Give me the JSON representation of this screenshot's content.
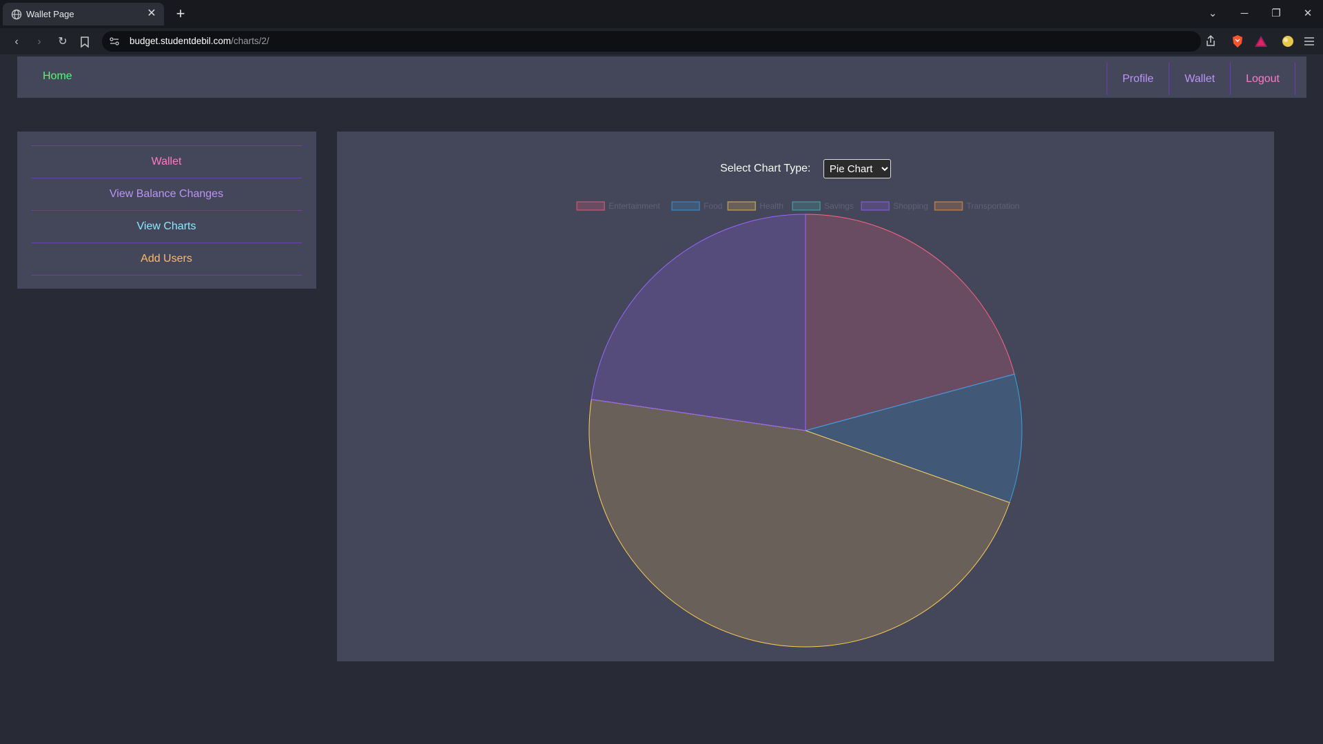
{
  "browser": {
    "tab_title": "Wallet Page",
    "url_host": "budget.studentdebil.com",
    "url_path": "/charts/2/"
  },
  "navbar": {
    "home": "Home",
    "links": [
      {
        "label": "Profile",
        "color": "#bd93f9"
      },
      {
        "label": "Wallet",
        "color": "#bd93f9"
      },
      {
        "label": "Logout",
        "color": "#ff79c6"
      }
    ]
  },
  "sidebar": {
    "items": [
      {
        "label": "Wallet",
        "color": "#ff79c6"
      },
      {
        "label": "View Balance Changes",
        "color": "#bd93f9"
      },
      {
        "label": "View Charts",
        "color": "#8be9fd"
      },
      {
        "label": "Add Users",
        "color": "#ffb86c"
      }
    ]
  },
  "chart_selector": {
    "label": "Select Chart Type:",
    "selected": "Pie Chart",
    "options": [
      "Pie Chart"
    ]
  },
  "chart_data": {
    "type": "pie",
    "title": "",
    "legend_position": "top",
    "categories": [
      "Entertainment",
      "Food",
      "Health",
      "Savings",
      "Shopping",
      "Transportation"
    ],
    "values": [
      20.8,
      9.6,
      46.9,
      0,
      22.7,
      0
    ],
    "colors": [
      "#ff6384",
      "#36a2eb",
      "#ffcd56",
      "#4bc0c0",
      "#9966ff",
      "#ff9f40"
    ]
  }
}
